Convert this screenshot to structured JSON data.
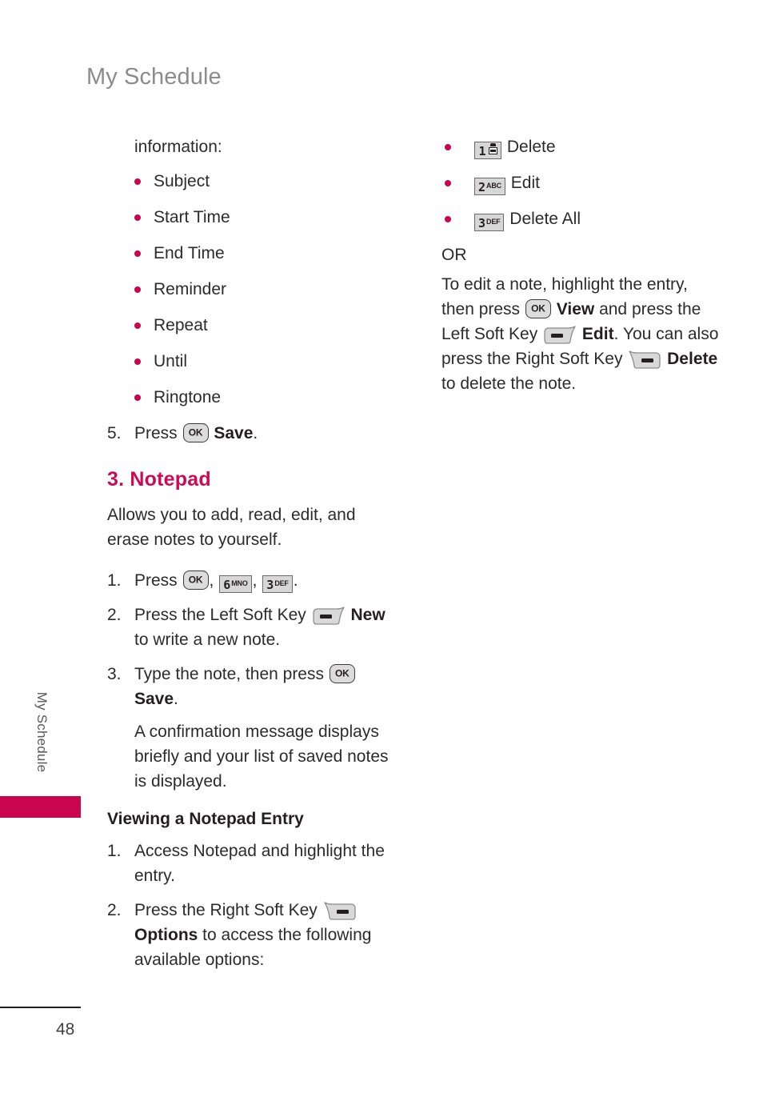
{
  "header": {
    "title": "My Schedule"
  },
  "sidebar": {
    "label": "My Schedule"
  },
  "footer": {
    "page_number": "48"
  },
  "colors": {
    "accent": "#c8054e",
    "heading": "#cc0a55",
    "header_gray": "#8a8c8e",
    "body_text": "#2b2b2b",
    "key_fill": "#d7d7d7"
  },
  "left_column": {
    "lead_in": "information:",
    "field_bullets": [
      {
        "label": "Subject"
      },
      {
        "label": "Start Time"
      },
      {
        "label": "End Time"
      },
      {
        "label": "Reminder"
      },
      {
        "label": "Repeat"
      },
      {
        "label": "Until"
      },
      {
        "label": "Ringtone"
      }
    ],
    "step5": {
      "number": "5.",
      "pre": "Press ",
      "key": "ok-key",
      "bold": "Save",
      "post": "."
    },
    "section_heading": "3. Notepad",
    "intro": "Allows you to add, read, edit, and erase notes to yourself.",
    "steps": [
      {
        "number": "1.",
        "pre": "Press ",
        "keys": [
          "OK",
          "6 MNO",
          "3 DEF"
        ],
        "post": "."
      },
      {
        "number": "2.",
        "pre": "Press the Left Soft Key ",
        "bold": "New",
        "post": " to write a new note."
      },
      {
        "number": "3.",
        "pre": "Type the note, then press ",
        "bold": "Save",
        "post": ".",
        "sub": "A confirmation message displays briefly and your list of saved notes is displayed."
      }
    ],
    "sub_heading": "Viewing a Notepad Entry",
    "view_steps": [
      {
        "number": "1.",
        "text": "Access Notepad and highlight the entry."
      },
      {
        "number": "2.",
        "pre": "Press the Right Soft Key ",
        "bold": "Options",
        "post": " to access the following available options:"
      }
    ]
  },
  "right_column": {
    "option_bullets": [
      {
        "key_digit": "1",
        "key_letters": "",
        "key_glyph": "voicemail",
        "label": "Delete"
      },
      {
        "key_digit": "2",
        "key_letters": "ABC",
        "key_glyph": "",
        "label": "Edit"
      },
      {
        "key_digit": "3",
        "key_letters": "DEF",
        "key_glyph": "",
        "label": "Delete All"
      }
    ],
    "or_text": "OR",
    "edit_note": {
      "p1": "To edit a note, highlight the entry, then press ",
      "view_bold": "View",
      "p2": " and press the Left Soft Key ",
      "edit_bold": "Edit",
      "p3": ". You can also press the Right Soft Key ",
      "delete_bold": "Delete",
      "p4": " to delete the note."
    }
  },
  "icons": {
    "ok": "ok-key-icon",
    "left_soft": "left-soft-key-icon",
    "right_soft": "right-soft-key-icon",
    "key_6": "keypad-6-mno-icon",
    "key_3": "keypad-3-def-icon",
    "key_1": "keypad-1-voicemail-icon",
    "key_2": "keypad-2-abc-icon"
  }
}
